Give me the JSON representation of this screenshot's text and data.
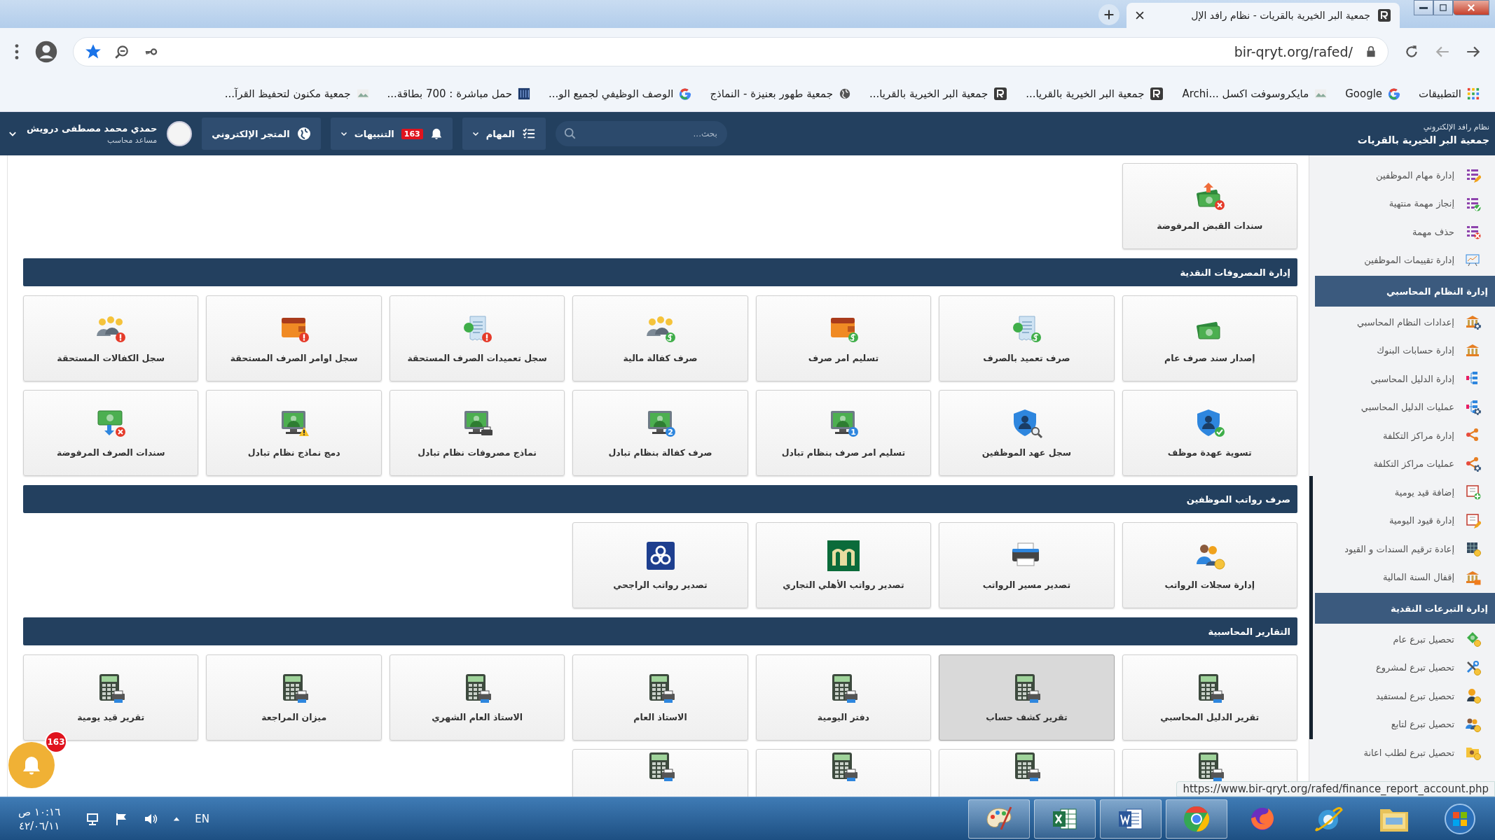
{
  "browser": {
    "tab": {
      "title": "جمعية البر الخيرية بالقريات - نظام رافد الإل"
    },
    "url": "bir-qryt.org/rafed/",
    "bookmarks": [
      {
        "label": "التطبيقات"
      },
      {
        "label": "Google"
      },
      {
        "label": "مايكروسوفت اكسل ...Archi"
      },
      {
        "label": "جمعية البر الخيرية بالقريا..."
      },
      {
        "label": "جمعية البر الخيرية بالقريا..."
      },
      {
        "label": "جمعية طهور بعنيزة - النماذج"
      },
      {
        "label": "الوصف الوظيفي لجميع الو..."
      },
      {
        "label": "حمل مباشرة : 700 بطاقة..."
      },
      {
        "label": "جمعية مكنون لتحفيظ القرآ..."
      }
    ]
  },
  "header": {
    "subtitle": "نظام رافد الإلكتروني",
    "title": "جمعية البر الخيرية بالقريات",
    "search_placeholder": "بحث...",
    "tasks": "المهام",
    "alerts": {
      "label": "التنبيهات",
      "count": "163"
    },
    "store": "المتجر الإلكتروني",
    "user": {
      "name": "حمدي محمد مصطفى درويش",
      "role": "مساعد محاسب"
    }
  },
  "sidebar": {
    "items": [
      {
        "kind": "link",
        "label": "إدارة مهام الموظفين"
      },
      {
        "kind": "link",
        "label": "إنجاز مهمة منتهية"
      },
      {
        "kind": "link",
        "label": "حذف مهمة"
      },
      {
        "kind": "link",
        "label": "إدارة تقييمات الموظفين"
      },
      {
        "kind": "heading",
        "label": "إدارة النظام المحاسبي"
      },
      {
        "kind": "link",
        "label": "إعدادات النظام المحاسبي"
      },
      {
        "kind": "link",
        "label": "إدارة حسابات البنوك"
      },
      {
        "kind": "link",
        "label": "إدارة الدليل المحاسبي"
      },
      {
        "kind": "link",
        "label": "عمليات الدليل المحاسبي"
      },
      {
        "kind": "link",
        "label": "إدارة مراكز التكلفة"
      },
      {
        "kind": "link",
        "label": "عمليات مراكز التكلفة"
      },
      {
        "kind": "link",
        "label": "إضافة قيد يومية"
      },
      {
        "kind": "link",
        "label": "إدارة قيود اليومية"
      },
      {
        "kind": "link",
        "label": "إعادة ترقيم السندات و القيود"
      },
      {
        "kind": "link",
        "label": "إقفال السنة المالية"
      },
      {
        "kind": "heading",
        "label": "إدارة التبرعات النقدية"
      },
      {
        "kind": "link",
        "label": "تحصيل تبرع عام"
      },
      {
        "kind": "link",
        "label": "تحصيل تبرع لمشروع"
      },
      {
        "kind": "link",
        "label": "تحصيل تبرع لمستفيد"
      },
      {
        "kind": "link",
        "label": "تحصيل تبرع لتابع"
      },
      {
        "kind": "link",
        "label": "تحصيل تبرع لطلب اعانة"
      }
    ]
  },
  "sections": [
    {
      "cards": [
        {
          "label": "سندات القبض المرفوضة",
          "selected": false
        }
      ]
    },
    {
      "title": "إدارة المصروفات النقدية",
      "cards": [
        {
          "label": "إصدار سند صرف عام",
          "selected": false
        },
        {
          "label": "صرف تعميد بالصرف",
          "selected": false
        },
        {
          "label": "تسليم امر صرف",
          "selected": false
        },
        {
          "label": "صرف كفالة مالية",
          "selected": false
        },
        {
          "label": "سجل تعميدات الصرف المستحقة",
          "selected": false
        },
        {
          "label": "سجل اوامر الصرف المستحقة",
          "selected": false
        },
        {
          "label": "سجل الكفالات المستحقة",
          "selected": false
        },
        {
          "label": "تسوية عهدة موظف",
          "selected": false
        },
        {
          "label": "سجل عهد الموظفين",
          "selected": false
        },
        {
          "label": "تسليم امر صرف بنظام تبادل",
          "badge_text": "1",
          "selected": false
        },
        {
          "label": "صرف كفالة بنظام تبادل",
          "badge_text": "2",
          "selected": false
        },
        {
          "label": "نماذج مصروفات نظام تبادل",
          "selected": false
        },
        {
          "label": "دمج نماذج نظام تبادل",
          "selected": false
        },
        {
          "label": "سندات الصرف المرفوضة",
          "selected": false
        }
      ]
    },
    {
      "title": "صرف رواتب الموظفين",
      "cards": [
        {
          "label": "إدارة سجلات الرواتب",
          "selected": false
        },
        {
          "label": "تصدير مسير الرواتب",
          "selected": false
        },
        {
          "label": "تصدير رواتب الأهلي التجاري",
          "selected": false
        },
        {
          "label": "تصدير رواتب الراجحي",
          "selected": false
        }
      ]
    },
    {
      "title": "التقارير المحاسبية",
      "cards": [
        {
          "label": "تقرير الدليل المحاسبي",
          "selected": false
        },
        {
          "label": "تقرير كشف حساب",
          "selected": true
        },
        {
          "label": "دفتر اليومية",
          "selected": false
        },
        {
          "label": "الاستاذ العام",
          "selected": false
        },
        {
          "label": "الاستاذ العام الشهري",
          "selected": false
        },
        {
          "label": "ميزان المراجعة",
          "selected": false
        },
        {
          "label": "تقرير قيد يومية",
          "selected": false
        },
        {
          "selected": false
        },
        {
          "selected": false
        },
        {
          "selected": false
        },
        {
          "selected": false
        }
      ]
    }
  ],
  "floating_alerts": {
    "count": "163"
  },
  "status_url": "https://www.bir-qryt.org/rafed/finance_report_account.php",
  "taskbar": {
    "apps": [
      {
        "running": false
      },
      {
        "running": false
      },
      {
        "running": false
      },
      {
        "running": false
      },
      {
        "running": true
      },
      {
        "running": true
      },
      {
        "running": true
      },
      {
        "running": true
      }
    ],
    "language": "EN",
    "time": "١٠:١٦ ص",
    "date": "٤٢/٠٦/١١"
  }
}
